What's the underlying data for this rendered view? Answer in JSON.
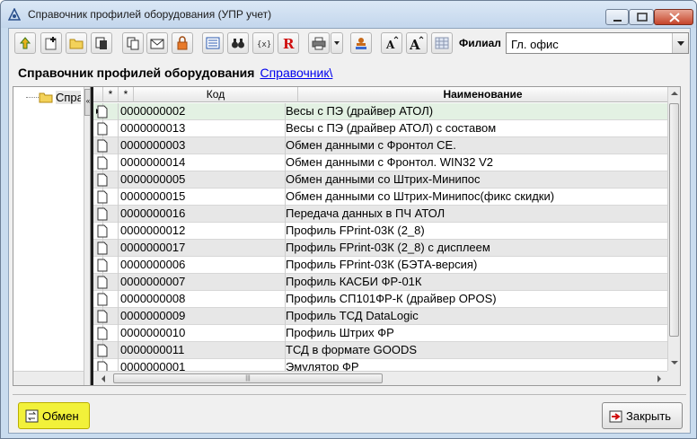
{
  "window": {
    "title": "Справочник профилей оборудования (УПР учет)"
  },
  "toolbar": {
    "buttons": [
      "up-arrow-icon",
      "new-folder-icon",
      "folder-icon",
      "copy-doc-icon",
      "copy-icon",
      "envelope-icon",
      "lock-icon",
      "list-view-icon",
      "binoculars-icon",
      "formula-icon",
      "report-r-icon",
      "printer-icon",
      "printer-dropdown-icon",
      "stamp-icon",
      "font-decrease-icon",
      "font-increase-icon",
      "grid-icon"
    ],
    "filial_label": "Филиал",
    "filial_value": "Гл. офис"
  },
  "header": {
    "title": "Справочник профилей оборудования",
    "link": "Справочник\\"
  },
  "tree": {
    "label": "Справ"
  },
  "grid": {
    "columns": [
      "*",
      "*",
      "Код",
      "Наименование"
    ],
    "rows": [
      {
        "code": "0000000002",
        "name": "Весы с ПЭ (драйвер АТОЛ)"
      },
      {
        "code": "0000000013",
        "name": "Весы с ПЭ (драйвер АТОЛ) с составом"
      },
      {
        "code": "0000000003",
        "name": "Обмен данными с Фронтол CE."
      },
      {
        "code": "0000000014",
        "name": "Обмен данными с Фронтол. WIN32 V2"
      },
      {
        "code": "0000000005",
        "name": "Обмен данными со Штрих-Минипос"
      },
      {
        "code": "0000000015",
        "name": "Обмен данными со Штрих-Минипос(фикс скидки)"
      },
      {
        "code": "0000000016",
        "name": "Передача данных в  ПЧ АТОЛ"
      },
      {
        "code": "0000000012",
        "name": "Профиль FPrint-03К (2_8)"
      },
      {
        "code": "0000000017",
        "name": "Профиль FPrint-03К (2_8) с дисплеем"
      },
      {
        "code": "0000000006",
        "name": "Профиль FPrint-03К (БЭТА-версия)"
      },
      {
        "code": "0000000007",
        "name": "Профиль КАСБИ ФР-01К"
      },
      {
        "code": "0000000008",
        "name": "Профиль СП101ФР-К (драйвер OPOS)"
      },
      {
        "code": "0000000009",
        "name": "Профиль ТСД DataLogic"
      },
      {
        "code": "0000000010",
        "name": "Профиль Штрих ФР"
      },
      {
        "code": "0000000011",
        "name": "ТСД в формате GOODS"
      },
      {
        "code": "0000000001",
        "name": "Эмулятор ФР"
      }
    ]
  },
  "footer": {
    "exchange_label": "Обмен",
    "close_label": "Закрыть"
  },
  "colors": {
    "selected_row": "#e3f1e3",
    "alt_row": "#e7e7e7",
    "exchange_button": "#f2f13a",
    "link": "#0000ee"
  }
}
